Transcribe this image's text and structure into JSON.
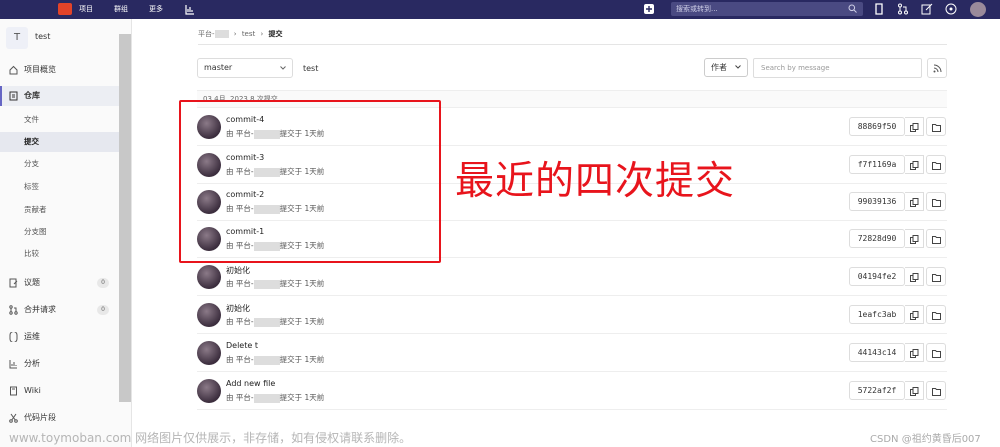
{
  "topbar": {
    "nav": [
      "项目",
      "群组",
      "更多"
    ],
    "search_placeholder": "搜索或转到..."
  },
  "sidebar": {
    "project_initial": "T",
    "project_name": "test",
    "items": [
      {
        "label": "项目概览",
        "icon": "home-icon"
      },
      {
        "label": "仓库",
        "icon": "repository-icon"
      },
      {
        "label": "议题",
        "icon": "issues-icon",
        "count": "0"
      },
      {
        "label": "合并请求",
        "icon": "merge-request-icon",
        "count": "0"
      },
      {
        "label": "运维",
        "icon": "operations-icon"
      },
      {
        "label": "分析",
        "icon": "analytics-icon"
      },
      {
        "label": "Wiki",
        "icon": "wiki-icon"
      },
      {
        "label": "代码片段",
        "icon": "snippets-icon"
      }
    ],
    "repo_subitems": [
      "文件",
      "提交",
      "分支",
      "标签",
      "贡献者",
      "分支图",
      "比较"
    ]
  },
  "breadcrumb": {
    "root": "平台-",
    "project": "test",
    "current": "提交"
  },
  "toolbar": {
    "branch": "master",
    "path": "test",
    "author_label": "作者",
    "search_placeholder": "Search by message"
  },
  "day_header": "03 4月, 2023 8 次提交",
  "commits": [
    {
      "title": "commit-4",
      "by": "由 平台-",
      "time": "提交于 1天前",
      "sha": "88869f50"
    },
    {
      "title": "commit-3",
      "by": "由 平台-",
      "time": "提交于 1天前",
      "sha": "f7f1169a"
    },
    {
      "title": "commit-2",
      "by": "由 平台-",
      "time": "提交于 1天前",
      "sha": "99039136"
    },
    {
      "title": "commit-1",
      "by": "由 平台-",
      "time": "提交于 1天前",
      "sha": "72828d90"
    },
    {
      "title": "初始化",
      "by": "由 平台-",
      "time": "提交于 1天前",
      "sha": "04194fe2"
    },
    {
      "title": "初始化",
      "by": "由 平台-",
      "time": "提交于 1天前",
      "sha": "1eafc3ab"
    },
    {
      "title": "Delete t",
      "by": "由 平台-",
      "time": "提交于 1天前",
      "sha": "44143c14"
    },
    {
      "title": "Add new file",
      "by": "由 平台-",
      "time": "提交于 1天前",
      "sha": "5722af2f"
    }
  ],
  "annotation": "最近的四次提交",
  "watermark_left": "www.toymoban.com 网络图片仅供展示，非存储，如有侵权请联系删除。",
  "watermark_right": "CSDN @祖约黄昏后007",
  "colors": {
    "topbar": "#292961",
    "annotation": "#e8141c",
    "active_bar": "#6666c4"
  }
}
